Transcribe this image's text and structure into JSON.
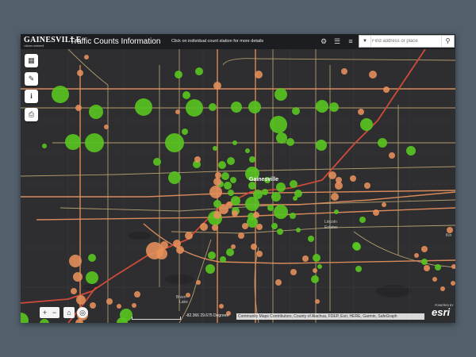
{
  "header": {
    "logo_text": "GAINESVILLE",
    "logo_tagline": "citizen centered",
    "title": "Traffic Counts Information",
    "subtitle": "Click on individual count station for more details"
  },
  "search": {
    "placeholder": "Find address or place"
  },
  "map_labels": {
    "city": "Gainesville",
    "lincoln": "Lincoln",
    "estates": "Estates",
    "kin": "Kin",
    "biven": "Biven",
    "lake": "Lake"
  },
  "footer": {
    "coords": "-82.366 29.675 Degrees",
    "attribution": "Community Maps Contributors, County of Alachua, FDEP, Esri, HERE, Garmin, SafeGraph",
    "powered": "POWERED BY",
    "esri": "esri"
  },
  "colors": {
    "green_station": "#58c322",
    "orange_station": "#e8915a",
    "road_main": "#c99a6a",
    "road_secondary": "#c8b078",
    "road_highway": "#d04a3a",
    "background": "#2c2c2e"
  },
  "icons": {
    "basemap": "grid-icon",
    "draw": "pencil-icon",
    "info": "info-icon",
    "print": "printer-icon",
    "zoom_in": "plus-icon",
    "zoom_out": "minus-icon",
    "home": "home-icon",
    "locate": "locate-icon"
  }
}
